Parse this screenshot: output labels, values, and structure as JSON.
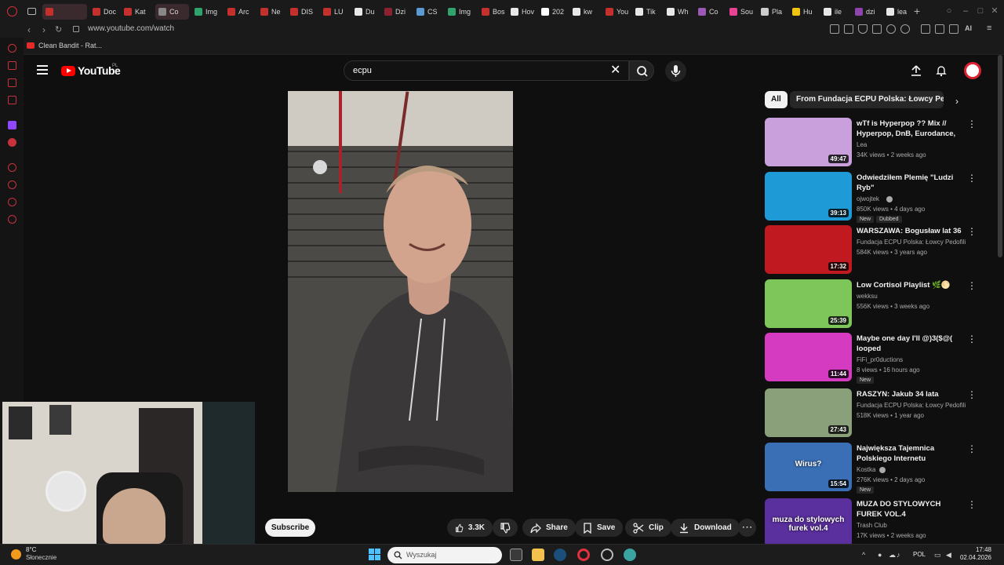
{
  "browser": {
    "tabs": [
      {
        "label": "",
        "color": "#c4302b",
        "active": true
      },
      {
        "label": "Doc",
        "color": "#c4302b"
      },
      {
        "label": "Kat",
        "color": "#c4302b"
      },
      {
        "label": "Co",
        "color": "#888888",
        "active": true
      },
      {
        "label": "Img",
        "color": "#2fa36b"
      },
      {
        "label": "Arc",
        "color": "#c4302b"
      },
      {
        "label": "Ne",
        "color": "#c4302b"
      },
      {
        "label": "DIS",
        "color": "#c4302b"
      },
      {
        "label": "LU",
        "color": "#c4302b"
      },
      {
        "label": "Du",
        "color": "#e8e8e8"
      },
      {
        "label": "Dzi",
        "color": "#8a2232"
      },
      {
        "label": "CS",
        "color": "#5b9bd5"
      },
      {
        "label": "Img",
        "color": "#2fa36b"
      },
      {
        "label": "Bos",
        "color": "#c4302b"
      },
      {
        "label": "Hov",
        "color": "#e8e8e8"
      },
      {
        "label": "202",
        "color": "#ffffff"
      },
      {
        "label": "kw",
        "color": "#e8e8e8"
      },
      {
        "label": "You",
        "color": "#c4302b"
      },
      {
        "label": "Tik",
        "color": "#e8e8e8"
      },
      {
        "label": "Wh",
        "color": "#e8e8e8"
      },
      {
        "label": "Co",
        "color": "#9b59b6"
      },
      {
        "label": "Sou",
        "color": "#e84393"
      },
      {
        "label": "Pla",
        "color": "#cccccc"
      },
      {
        "label": "Hu",
        "color": "#f1c40f"
      },
      {
        "label": "ile",
        "color": "#e8e8e8"
      },
      {
        "label": "dzi",
        "color": "#8e44ad"
      },
      {
        "label": "lea",
        "color": "#e8e8e8"
      }
    ],
    "url": "www.youtube.com/watch",
    "bookmark": "Clean Bandit - Rat..."
  },
  "youtube": {
    "logo_text": "YouTube",
    "region": "PL",
    "search_query": "ecpu",
    "actions": {
      "subscribe": "Subscribe",
      "likes": "3.3K",
      "share": "Share",
      "save": "Save",
      "clip": "Clip",
      "download": "Download",
      "more": "⋯"
    },
    "chips": {
      "all": "All",
      "from": "From Fundacja ECPU Polska: Łowcy Pedofili"
    },
    "recommendations": [
      {
        "title": "wTf is Hyperpop ?? Mix // Hyperpop, DnB, Eurodance, J-...",
        "channel": "Lea",
        "meta": "34K views • 2 weeks ago",
        "duration": "49:47",
        "thumb_color": "#c9a0dc",
        "verified": false,
        "badges": []
      },
      {
        "title": "Odwiedziłem Plemię \"Ludzi Ryb\"",
        "channel": "ojwojtek",
        "meta": "850K views • 4 days ago",
        "duration": "39:13",
        "thumb_color": "#1e9ad6",
        "verified": true,
        "badges": [
          "New",
          "Dubbed"
        ]
      },
      {
        "title": "WARSZAWA: Bogusław lat 36",
        "channel": "Fundacja ECPU Polska: Łowcy Pedofili",
        "meta": "584K views • 3 years ago",
        "duration": "17:32",
        "thumb_color": "#c0191f",
        "verified": false,
        "badges": []
      },
      {
        "title": "Low Cortisol Playlist 🌿🌕",
        "channel": "wekksu",
        "meta": "556K views • 3 weeks ago",
        "duration": "25:39",
        "thumb_color": "#7fc65a",
        "verified": false,
        "badges": []
      },
      {
        "title": "Maybe one day I'll @)3($@( looped",
        "channel": "FiFi_pr0ductions",
        "meta": "8 views • 16 hours ago",
        "duration": "11:44",
        "thumb_color": "#d43bc1",
        "verified": false,
        "badges": [
          "New"
        ]
      },
      {
        "title": "RASZYN: Jakub 34 lata",
        "channel": "Fundacja ECPU Polska: Łowcy Pedofili",
        "meta": "518K views • 1 year ago",
        "duration": "27:43",
        "thumb_color": "#8aa07a",
        "verified": false,
        "badges": []
      },
      {
        "title": "Największa Tajemnica Polskiego Internetu",
        "channel": "Kostka",
        "meta": "276K views • 2 days ago",
        "duration": "15:54",
        "thumb_color": "#3a6fb5",
        "verified": true,
        "badges": [
          "New"
        ],
        "thumb_text": "Wirus?"
      },
      {
        "title": "MUZA DO STYLOWYCH FUREK VOL.4",
        "channel": "Trash Club",
        "meta": "17K views • 2 weeks ago",
        "duration": "",
        "thumb_color": "#5a2f9e",
        "verified": false,
        "badges": [],
        "thumb_text": "muza do stylowych furek vol.4"
      }
    ]
  },
  "taskbar": {
    "temperature": "8°C",
    "weather": "Słonecznie",
    "search_placeholder": "Wyszukaj",
    "language": "POL",
    "time": "17:48",
    "date": "02.04.2026"
  }
}
